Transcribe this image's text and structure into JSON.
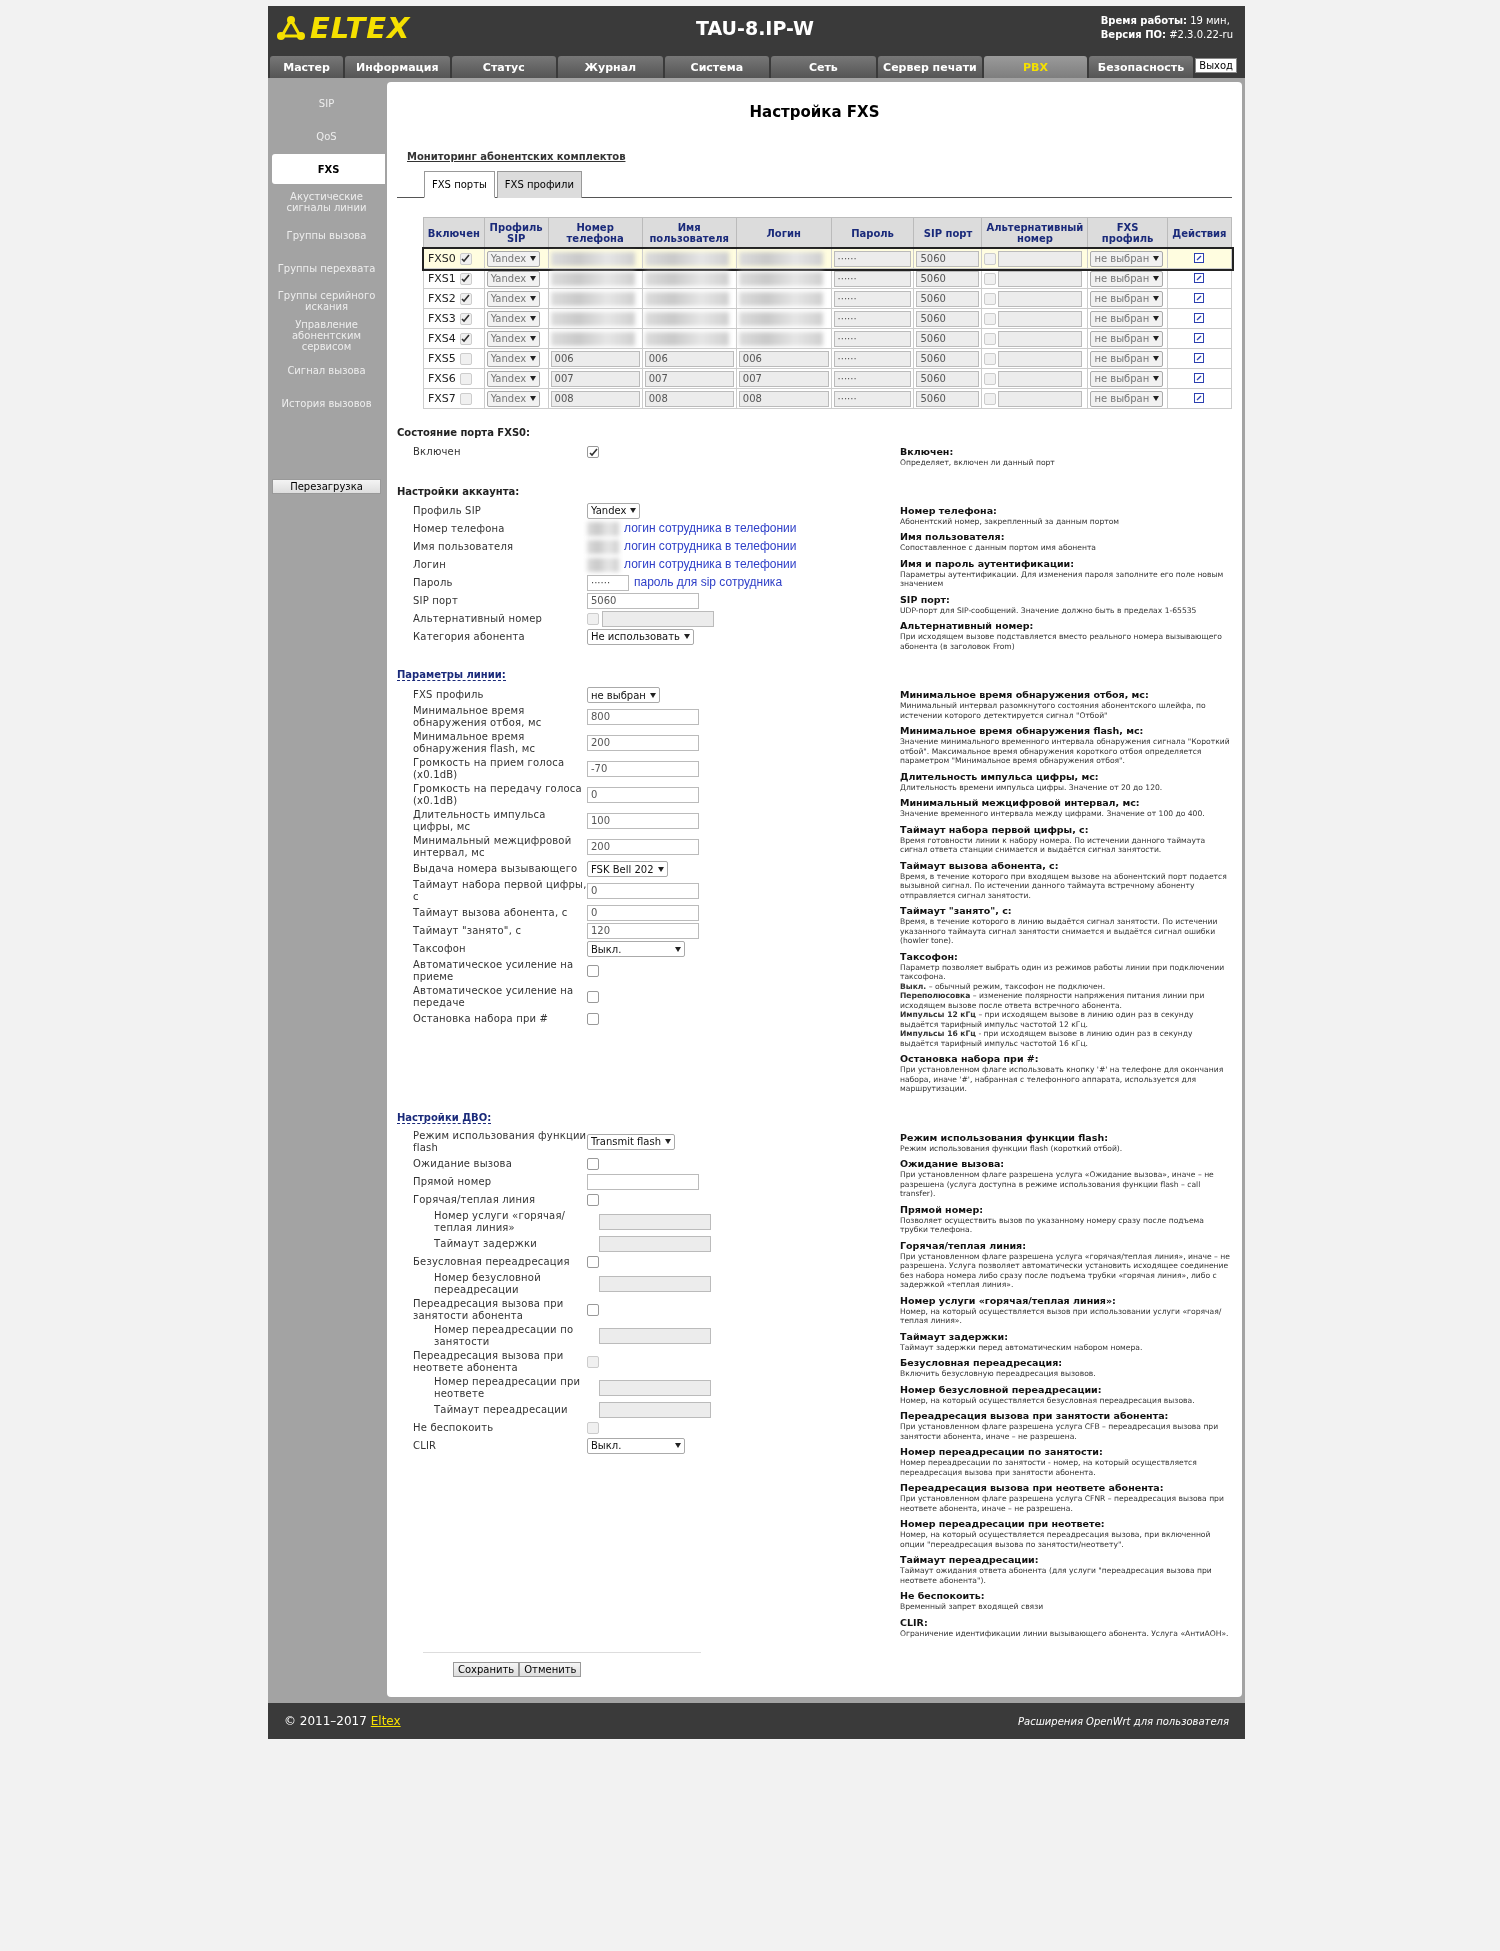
{
  "header": {
    "logo": "ELTEX",
    "device": "TAU-8.IP-W",
    "uptime_label": "Время работы:",
    "uptime": "19 мин,",
    "version_label": "Версия ПО:",
    "version": "#2.3.0.22-ru"
  },
  "tabs": [
    {
      "label": "Мастер",
      "selected": false
    },
    {
      "label": "Информация",
      "selected": false
    },
    {
      "label": "Статус",
      "selected": false
    },
    {
      "label": "Журнал",
      "selected": false
    },
    {
      "label": "Система",
      "selected": false
    },
    {
      "label": "Сеть",
      "selected": false
    },
    {
      "label": "Сервер печати",
      "selected": false
    },
    {
      "label": "PBX",
      "selected": true
    },
    {
      "label": "Безопасность",
      "selected": false
    }
  ],
  "logout": "Выход",
  "sidebar": {
    "items": [
      {
        "label": "SIP",
        "selected": false
      },
      {
        "label": "QoS",
        "selected": false
      },
      {
        "label": "FXS",
        "selected": true
      },
      {
        "label": "Акустические сигналы линии",
        "selected": false
      },
      {
        "label": "Группы вызова",
        "selected": false
      },
      {
        "label": "Группы перехвата",
        "selected": false
      },
      {
        "label": "Группы серийного искания",
        "selected": false
      },
      {
        "label": "Управление абонентским сервисом",
        "selected": false
      },
      {
        "label": "Сигнал вызова",
        "selected": false
      },
      {
        "label": "История вызовов",
        "selected": false
      }
    ],
    "reboot": "Перезагрузка"
  },
  "page_title": "Настройка FXS",
  "monitor_link": "Мониторинг абонентских комплектов",
  "subtabs": [
    {
      "label": "FXS порты",
      "selected": true
    },
    {
      "label": "FXS профили",
      "selected": false
    }
  ],
  "ports_table": {
    "columns": [
      "Включен",
      "Профиль SIP",
      "Номер телефона",
      "Имя пользователя",
      "Логин",
      "Пароль",
      "SIP порт",
      "Альтернативный номер",
      "FXS профиль",
      "Действия"
    ],
    "rows": [
      {
        "port": "FXS0",
        "enabled": true,
        "selected": true,
        "sip_profile": "Yandex",
        "blurred": true,
        "password": "······",
        "sip_port": "5060",
        "fxs_profile": "не выбран"
      },
      {
        "port": "FXS1",
        "enabled": true,
        "selected": false,
        "sip_profile": "Yandex",
        "blurred": true,
        "password": "······",
        "sip_port": "5060",
        "fxs_profile": "не выбран"
      },
      {
        "port": "FXS2",
        "enabled": true,
        "selected": false,
        "sip_profile": "Yandex",
        "blurred": true,
        "password": "······",
        "sip_port": "5060",
        "fxs_profile": "не выбран"
      },
      {
        "port": "FXS3",
        "enabled": true,
        "selected": false,
        "sip_profile": "Yandex",
        "blurred": true,
        "password": "······",
        "sip_port": "5060",
        "fxs_profile": "не выбран"
      },
      {
        "port": "FXS4",
        "enabled": true,
        "selected": false,
        "sip_profile": "Yandex",
        "blurred": true,
        "password": "······",
        "sip_port": "5060",
        "fxs_profile": "не выбран"
      },
      {
        "port": "FXS5",
        "enabled": false,
        "selected": false,
        "sip_profile": "Yandex",
        "blurred": false,
        "phone": "006",
        "username": "006",
        "login": "006",
        "password": "······",
        "sip_port": "5060",
        "fxs_profile": "не выбран"
      },
      {
        "port": "FXS6",
        "enabled": false,
        "selected": false,
        "sip_profile": "Yandex",
        "blurred": false,
        "phone": "007",
        "username": "007",
        "login": "007",
        "password": "······",
        "sip_port": "5060",
        "fxs_profile": "не выбран"
      },
      {
        "port": "FXS7",
        "enabled": false,
        "selected": false,
        "sip_profile": "Yandex",
        "blurred": false,
        "phone": "008",
        "username": "008",
        "login": "008",
        "password": "······",
        "sip_port": "5060",
        "fxs_profile": "не выбран"
      }
    ]
  },
  "sections": [
    {
      "title": "Состояние порта FXS0:",
      "link": false,
      "rows": [
        {
          "label": "Включен",
          "kind": "checkbox",
          "checked": true,
          "disabled": false
        }
      ],
      "help": [
        {
          "title": "Включен:",
          "lines": [
            "Определяет, включен ли данный порт"
          ]
        }
      ]
    },
    {
      "title": "Настройки аккаунта:",
      "link": false,
      "rows": [
        {
          "label": "Профиль SIP",
          "kind": "select",
          "value": "Yandex"
        },
        {
          "label": "Номер телефона",
          "kind": "blurred",
          "annotation": "логин сотрудника в телефонии"
        },
        {
          "label": "Имя пользователя",
          "kind": "blurred",
          "annotation": "логин сотрудника в телефонии"
        },
        {
          "label": "Логин",
          "kind": "blurred",
          "annotation": "логин сотрудника в телефонии"
        },
        {
          "label": "Пароль",
          "kind": "password",
          "value": "······",
          "annotation": "пароль для sip сотрудника"
        },
        {
          "label": "SIP порт",
          "kind": "input",
          "value": "5060",
          "disabled": false
        },
        {
          "label": "Альтернативный номер",
          "kind": "check_input",
          "checked": false,
          "disabled": true
        },
        {
          "label": "Категория абонента",
          "kind": "select",
          "value": "Не использовать"
        }
      ],
      "help": [
        {
          "title": "Номер телефона:",
          "lines": [
            "Абонентский номер, закрепленный за данным портом"
          ]
        },
        {
          "title": "Имя пользователя:",
          "lines": [
            "Сопоставленное с данным портом имя абонента"
          ]
        },
        {
          "title": "Имя и пароль аутентификации:",
          "lines": [
            "Параметры аутентификации. Для изменения пароля заполните его поле новым значением"
          ]
        },
        {
          "title": "SIP порт:",
          "lines": [
            "UDP-порт для SIP-сообщений. Значение должно быть в пределах 1-65535"
          ]
        },
        {
          "title": "Альтернативный номер:",
          "lines": [
            "При исходящем вызове подставляется вместо реального номера вызывающего абонента (в заголовок From)"
          ]
        }
      ]
    },
    {
      "title": "Параметры линии:",
      "link": true,
      "rows": [
        {
          "label": "FXS профиль",
          "kind": "select",
          "value": "не выбран"
        },
        {
          "label": "Минимальное время обнаружения отбоя, мс",
          "kind": "input",
          "value": "800",
          "disabled": false
        },
        {
          "label": "Минимальное время обнаружения flash, мс",
          "kind": "input",
          "value": "200",
          "disabled": false
        },
        {
          "label": "Громкость на прием голоса (x0.1dB)",
          "kind": "input",
          "value": "-70",
          "disabled": false
        },
        {
          "label": "Громкость на передачу голоса (x0.1dB)",
          "kind": "input",
          "value": "0",
          "disabled": false
        },
        {
          "label": "Длительность импульса цифры, мс",
          "kind": "input",
          "value": "100",
          "disabled": false
        },
        {
          "label": "Минимальный межцифровой интервал, мс",
          "kind": "input",
          "value": "200",
          "disabled": false
        },
        {
          "label": "Выдача номера вызывающего",
          "kind": "select",
          "value": "FSK Bell 202"
        },
        {
          "label": "Таймаут набора первой цифры, с",
          "kind": "input",
          "value": "0",
          "disabled": false
        },
        {
          "label": "Таймаут вызова абонента, с",
          "kind": "input",
          "value": "0",
          "disabled": false
        },
        {
          "label": "Таймаут \"занято\", с",
          "kind": "input",
          "value": "120",
          "disabled": false
        },
        {
          "label": "Таксофон",
          "kind": "select",
          "value": "Выкл.",
          "wide": true
        },
        {
          "label": "Автоматическое усиление на приеме",
          "kind": "checkbox",
          "checked": false,
          "disabled": false
        },
        {
          "label": "Автоматическое усиление на передаче",
          "kind": "checkbox",
          "checked": false,
          "disabled": false
        },
        {
          "label": "Остановка набора при #",
          "kind": "checkbox",
          "checked": false,
          "disabled": false
        }
      ],
      "help": [
        {
          "title": "Минимальное время обнаружения отбоя, мс:",
          "lines": [
            "Минимальный интервал разомкнутого состояния абонентского шлейфа, по истечении которого детектируется сигнал \"Отбой\""
          ]
        },
        {
          "title": "Минимальное время обнаружения flash, мс:",
          "lines": [
            "Значение минимального временного интервала обнаружения сигнала \"Короткий отбой\". Максимальное время обнаружения короткого отбоя определяется параметром \"Минимальное время обнаружения отбоя\"."
          ]
        },
        {
          "title": "Длительность импульса цифры, мс:",
          "lines": [
            "Длительность времени импульса цифры. Значение от 20 до 120."
          ]
        },
        {
          "title": "Минимальный межцифровой интервал, мс:",
          "lines": [
            "Значение временного интервала между цифрами. Значение от 100 до 400."
          ]
        },
        {
          "title": "Таймаут набора первой цифры, с:",
          "lines": [
            "Время готовности линии к набору номера. По истечении данного таймаута сигнал ответа станции снимается и выдаётся сигнал занятости."
          ]
        },
        {
          "title": "Таймаут вызова абонента, с:",
          "lines": [
            "Время, в течение которого при входящем вызове на абонентский порт подается вызывной сигнал. По истечении данного таймаута встречному абоненту отправляется сигнал занятости."
          ]
        },
        {
          "title": "Таймаут \"занято\", с:",
          "lines": [
            "Время, в течение которого в линию выдаётся сигнал занятости. По истечении указанного таймаута сигнал занятости снимается и выдаётся сигнал ошибки (howler tone)."
          ]
        },
        {
          "title": "Таксофон:",
          "lines": [
            "Параметр позволяет выбрать один из режимов работы линии при подключении таксофона.",
            "**Выкл.** – обычный режим, таксофон не подключен.",
            "**Переполюсовка** – изменение полярности напряжения питания линии при исходящем вызове после ответа встречного абонента.",
            "**Импульсы 12 кГц** – при исходящем вызове в линию один раз в секунду выдаётся тарифный импульс частотой 12 кГц.",
            "**Импульсы 16 кГц** - при исходящем вызове в линию один раз в секунду выдаётся тарифный импульс частотой 16 кГц."
          ]
        },
        {
          "title": "Остановка набора при #:",
          "lines": [
            "При установленном флаге использовать кнопку '#' на телефоне для окончания набора, иначе '#', набранная с телефонного аппарата, используется для маршрутизации."
          ]
        }
      ]
    },
    {
      "title": "Настройки ДВО:",
      "link": true,
      "rows": [
        {
          "label": "Режим использования функции flash",
          "kind": "select",
          "value": "Transmit flash"
        },
        {
          "label": "Ожидание вызова",
          "kind": "checkbox",
          "checked": false,
          "disabled": false
        },
        {
          "label": "Прямой номер",
          "kind": "input",
          "value": "",
          "disabled": false
        },
        {
          "label": "Горячая/теплая линия",
          "kind": "checkbox",
          "checked": false,
          "disabled": false,
          "children": [
            {
              "label": "Номер услуги «горячая/теплая линия»",
              "kind": "input",
              "disabled": true
            },
            {
              "label": "Таймаут задержки",
              "kind": "input",
              "disabled": true
            }
          ]
        },
        {
          "label": "Безусловная переадресация",
          "kind": "checkbox",
          "checked": false,
          "disabled": false,
          "children": [
            {
              "label": "Номер безусловной переадресации",
              "kind": "input",
              "disabled": true
            }
          ]
        },
        {
          "label": "Переадресация вызова при занятости абонента",
          "kind": "checkbox",
          "checked": false,
          "disabled": false,
          "children": [
            {
              "label": "Номер переадресации по занятости",
              "kind": "input",
              "disabled": true
            }
          ]
        },
        {
          "label": "Переадресация вызова при неответе абонента",
          "kind": "checkbox",
          "checked": false,
          "disabled": true,
          "children": [
            {
              "label": "Номер переадресации при неответе",
              "kind": "input",
              "disabled": true
            },
            {
              "label": "Таймаут переадресации",
              "kind": "input",
              "disabled": true
            }
          ]
        },
        {
          "label": "Не беспокоить",
          "kind": "checkbox",
          "checked": false,
          "disabled": true
        },
        {
          "label": "CLIR",
          "kind": "select",
          "value": "Выкл.",
          "wide": true
        }
      ],
      "help": [
        {
          "title": "Режим использования функции flash:",
          "lines": [
            "Режим использования функции flash (короткий отбой)."
          ]
        },
        {
          "title": "Ожидание вызова:",
          "lines": [
            "При установленном флаге разрешена услуга «Ожидание вызова», иначе – не разрешена (услуга доступна в режиме использования функции flash – call transfer)."
          ]
        },
        {
          "title": "Прямой номер:",
          "lines": [
            "Позволяет осуществить вызов по указанному номеру сразу после подъема трубки телефона."
          ]
        },
        {
          "title": "Горячая/теплая линия:",
          "lines": [
            "При установленном флаге разрешена услуга «горячая/теплая линия», иначе – не разрешена. Услуга позволяет автоматически установить исходящее соединение без набора номера либо сразу после подъема трубки «горячая линия», либо с задержкой «теплая линия»."
          ]
        },
        {
          "title": "Номер услуги «горячая/теплая линия»:",
          "lines": [
            "Номер, на который осуществляется вызов при использовании услуги «горячая/теплая линия»."
          ]
        },
        {
          "title": "Таймаут задержки:",
          "lines": [
            "Таймаут задержки перед автоматическим набором номера."
          ]
        },
        {
          "title": "Безусловная переадресация:",
          "lines": [
            "Включить безусловную переадресация вызовов."
          ]
        },
        {
          "title": "Номер безусловной переадресации:",
          "lines": [
            "Номер, на который осуществляется безусловная переадресация вызова."
          ]
        },
        {
          "title": "Переадресация вызова при занятости абонента:",
          "lines": [
            "При установленном флаге разрешена услуга CFB – переадресация вызова при занятости абонента, иначе – не разрешена."
          ]
        },
        {
          "title": "Номер переадресации по занятости:",
          "lines": [
            "Номер переадресации по занятости - номер, на который осуществляется переадресация вызова при занятости абонента."
          ]
        },
        {
          "title": "Переадресация вызова при неответе абонента:",
          "lines": [
            "При установленном флаге разрешена услуга CFNR – переадресация вызова при неответе абонента, иначе – не разрешена."
          ]
        },
        {
          "title": "Номер переадресации при неответе:",
          "lines": [
            "Номер, на который осуществляется переадресация вызова, при включенной опции \"переадресация вызова по занятости/неответу\"."
          ]
        },
        {
          "title": "Таймаут переадресации:",
          "lines": [
            "Таймаут ожидания ответа абонента (для услуги \"переадресация вызова при неответе абонента\")."
          ]
        },
        {
          "title": "Не беспокоить:",
          "lines": [
            "Временный запрет входящей связи"
          ]
        },
        {
          "title": "CLIR:",
          "lines": [
            "Ограничение идентификации линии вызывающего абонента. Услуга «АнтиАОН»."
          ]
        }
      ]
    }
  ],
  "buttons": [
    "Сохранить",
    "Отменить"
  ],
  "footer": {
    "copyright": "© 2011–2017",
    "link": "Eltex",
    "right": "Расширения OpenWrt для пользователя"
  }
}
